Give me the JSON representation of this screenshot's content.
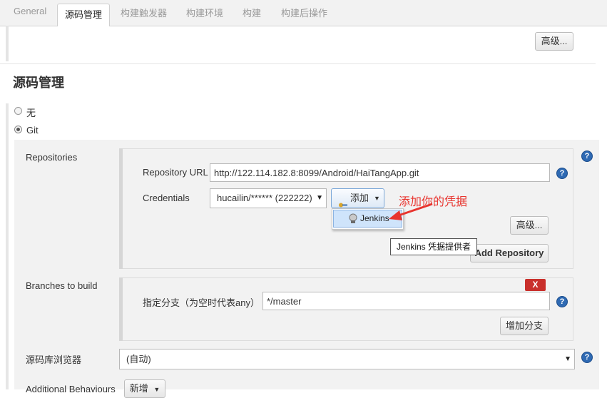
{
  "tabs": [
    {
      "label": "General"
    },
    {
      "label": "源码管理"
    },
    {
      "label": "构建触发器"
    },
    {
      "label": "构建环境"
    },
    {
      "label": "构建"
    },
    {
      "label": "构建后操作"
    }
  ],
  "top_advanced_label": "高级...",
  "section_title": "源码管理",
  "scm_options": [
    {
      "label": "无",
      "selected": false
    },
    {
      "label": "Git",
      "selected": true
    }
  ],
  "repositories": {
    "label": "Repositories",
    "url_label": "Repository URL",
    "url_value": "http://122.114.182.8:8099/Android/HaiTangApp.git",
    "credentials_label": "Credentials",
    "credentials_value": "hucailin/****** (222222)",
    "add_label": "添加",
    "dropdown_item": "Jenkins",
    "advanced_label": "高级...",
    "add_repo_label": "Add Repository",
    "tooltip": "Jenkins 凭据提供者"
  },
  "annotation": {
    "text": "添加你的凭据",
    "color": "#e8342e"
  },
  "branches": {
    "label": "Branches to build",
    "delete_label": "X",
    "spec_label": "指定分支（为空时代表any）",
    "spec_value": "*/master",
    "add_branch_label": "增加分支"
  },
  "browser": {
    "label": "源码库浏览器",
    "value": "(自动)"
  },
  "behaviours": {
    "label": "Additional Behaviours",
    "add_label": "新增"
  },
  "help_glyph": "?",
  "colors": {
    "help_icon": "#2f6ab3",
    "delete_button": "#c9302c",
    "tab_active_bg": "#ffffff"
  }
}
